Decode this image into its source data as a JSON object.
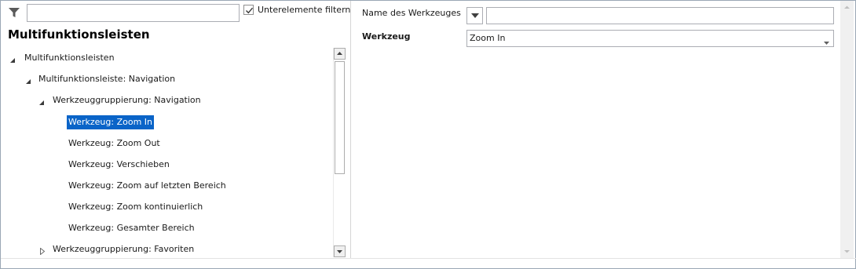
{
  "filter": {
    "search_value": "",
    "sub_filter_label": "Unterelemente filtern",
    "sub_filter_checked": true
  },
  "left_pane": {
    "title": "Multifunktionsleisten"
  },
  "tree": {
    "nodes": [
      {
        "label": "Multifunktionsleisten",
        "toggle": "expanded"
      },
      {
        "label": "Multifunktionsleiste: Navigation",
        "toggle": "expanded"
      },
      {
        "label": "Werkzeuggruppierung: Navigation",
        "toggle": "expanded"
      },
      {
        "label": "Werkzeug: Zoom In",
        "toggle": "none",
        "selected": true
      },
      {
        "label": "Werkzeug: Zoom Out",
        "toggle": "none"
      },
      {
        "label": "Werkzeug: Verschieben",
        "toggle": "none"
      },
      {
        "label": "Werkzeug: Zoom auf letzten Bereich",
        "toggle": "none"
      },
      {
        "label": "Werkzeug: Zoom kontinuierlich",
        "toggle": "none"
      },
      {
        "label": "Werkzeug: Gesamter Bereich",
        "toggle": "none"
      },
      {
        "label": "Werkzeuggruppierung: Favoriten",
        "toggle": "collapsed"
      }
    ]
  },
  "properties": {
    "name_label": "Name des Werkzeuges",
    "name_value": "",
    "tool_label": "Werkzeug",
    "tool_value": "Zoom In"
  },
  "colors": {
    "selection": "#0a64c8",
    "border": "#abadb3"
  }
}
